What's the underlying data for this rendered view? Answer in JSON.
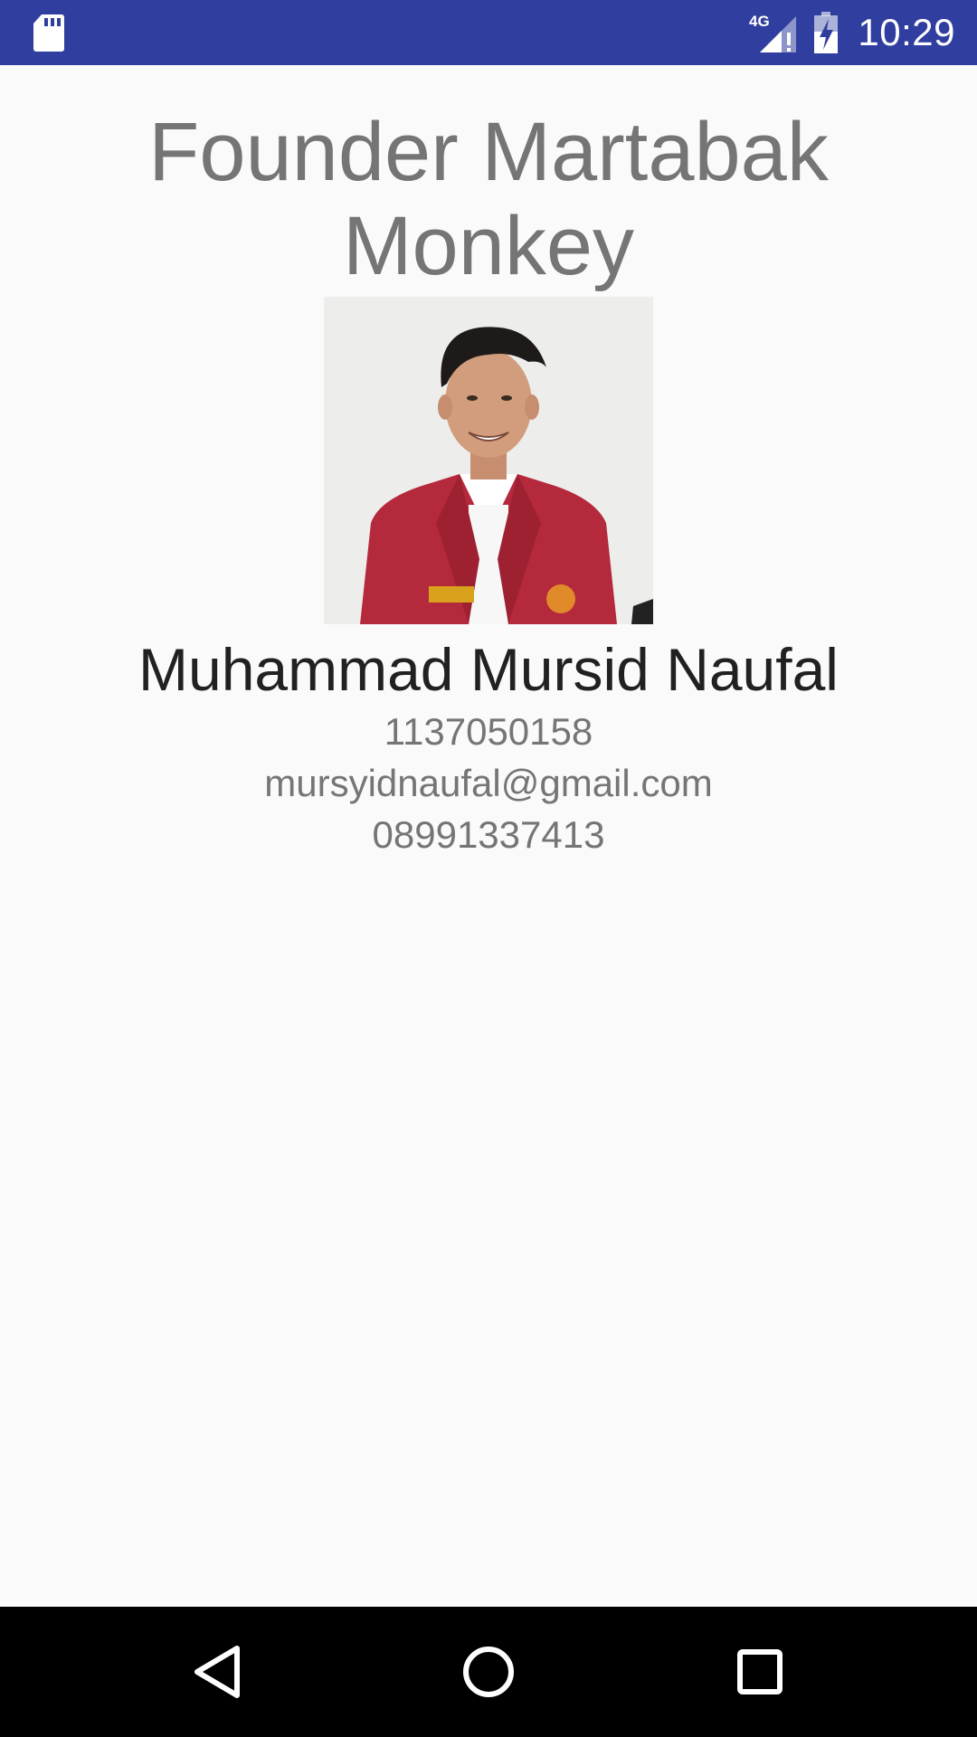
{
  "status_bar": {
    "time": "10:29",
    "network_label": "4G",
    "background_color": "#303f9f",
    "icons": [
      "sd-card-icon",
      "cellular-signal-icon",
      "battery-charging-icon"
    ]
  },
  "profile": {
    "title": "Founder Martabak Monkey",
    "name": "Muhammad Mursid Naufal",
    "student_id": "1137050158",
    "email": "mursyidnaufal@gmail.com",
    "phone": "08991337413"
  },
  "nav_bar": {
    "icons": [
      "back-icon",
      "home-icon",
      "recents-icon"
    ]
  }
}
